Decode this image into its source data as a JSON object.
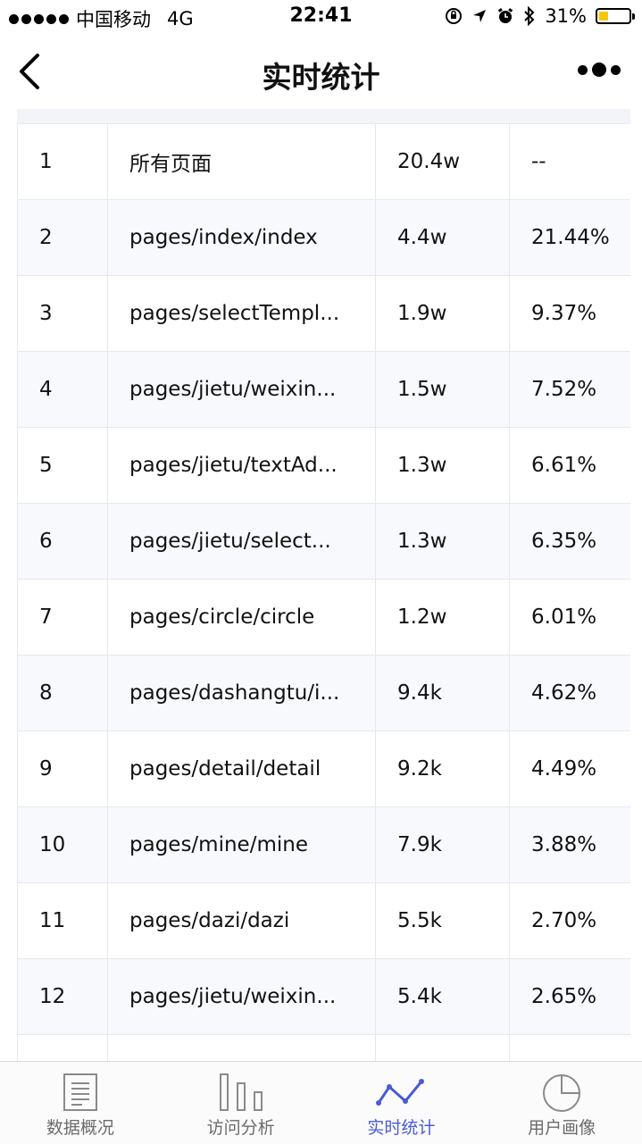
{
  "status_bar": {
    "carrier": "中国移动",
    "network": "4G",
    "time": "22:41",
    "battery_percent": "31%",
    "battery_level": 0.31
  },
  "nav": {
    "title": "实时统计"
  },
  "table": {
    "rows": [
      {
        "rank": "1",
        "page": "所有页面",
        "visits": "20.4w",
        "share": "--"
      },
      {
        "rank": "2",
        "page": "pages/index/index",
        "visits": "4.4w",
        "share": "21.44%"
      },
      {
        "rank": "3",
        "page": "pages/selectTempl...",
        "visits": "1.9w",
        "share": "9.37%"
      },
      {
        "rank": "4",
        "page": "pages/jietu/weixin...",
        "visits": "1.5w",
        "share": "7.52%"
      },
      {
        "rank": "5",
        "page": "pages/jietu/textAd...",
        "visits": "1.3w",
        "share": "6.61%"
      },
      {
        "rank": "6",
        "page": "pages/jietu/select...",
        "visits": "1.3w",
        "share": "6.35%"
      },
      {
        "rank": "7",
        "page": "pages/circle/circle",
        "visits": "1.2w",
        "share": "6.01%"
      },
      {
        "rank": "8",
        "page": "pages/dashangtu/i...",
        "visits": "9.4k",
        "share": "4.62%"
      },
      {
        "rank": "9",
        "page": "pages/detail/detail",
        "visits": "9.2k",
        "share": "4.49%"
      },
      {
        "rank": "10",
        "page": "pages/mine/mine",
        "visits": "7.9k",
        "share": "3.88%"
      },
      {
        "rank": "11",
        "page": "pages/dazi/dazi",
        "visits": "5.5k",
        "share": "2.70%"
      },
      {
        "rank": "12",
        "page": "pages/jietu/weixin...",
        "visits": "5.4k",
        "share": "2.65%"
      },
      {
        "rank": "",
        "page": "",
        "visits": "",
        "share": ""
      }
    ]
  },
  "tabs": [
    {
      "label": "数据概况",
      "icon": "document-list-icon",
      "active": false
    },
    {
      "label": "访问分析",
      "icon": "bar-columns-icon",
      "active": false
    },
    {
      "label": "实时统计",
      "icon": "line-trend-icon",
      "active": true
    },
    {
      "label": "用户画像",
      "icon": "pie-chart-icon",
      "active": false
    }
  ],
  "colors": {
    "accent": "#4a5bd4",
    "battery": "#f6c700"
  }
}
